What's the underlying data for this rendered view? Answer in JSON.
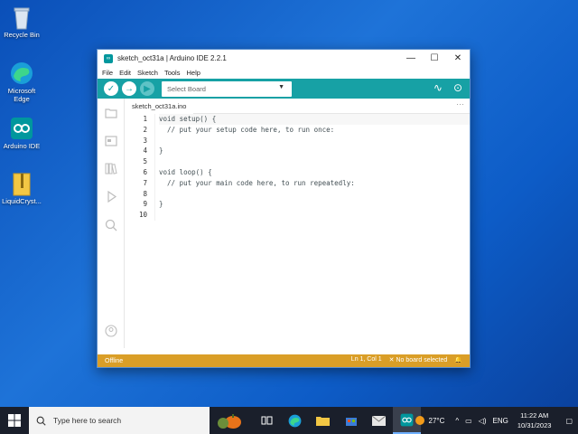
{
  "desktop": {
    "icons": [
      {
        "label": "Recycle Bin"
      },
      {
        "label": "Microsoft Edge"
      },
      {
        "label": "Arduino IDE"
      },
      {
        "label": "LiquidCryst..."
      }
    ]
  },
  "window": {
    "title": "sketch_oct31a | Arduino IDE 2.2.1",
    "app_icon_glyph": "∞",
    "controls": {
      "minimize": "—",
      "maximize": "☐",
      "close": "✕"
    },
    "menu": [
      "File",
      "Edit",
      "Sketch",
      "Tools",
      "Help"
    ]
  },
  "toolbar": {
    "verify": "✓",
    "upload": "→",
    "debug": "▶",
    "board_placeholder": "Select Board",
    "chevron": "▼",
    "serial_plotter": "∿",
    "serial_monitor": "⊙"
  },
  "editor": {
    "tab": "sketch_oct31a.ino",
    "tab_more": "···",
    "line_numbers": [
      "1",
      "2",
      "3",
      "4",
      "5",
      "6",
      "7",
      "8",
      "9",
      "10"
    ],
    "lines": [
      "void setup() {",
      "  // put your setup code here, to run once:",
      "",
      "}",
      "",
      "void loop() {",
      "  // put your main code here, to run repeatedly:",
      "",
      "}",
      ""
    ]
  },
  "status": {
    "left": "Offline",
    "position": "Ln 1, Col 1",
    "board": "✕ No board selected",
    "bell": "🔔"
  },
  "taskbar": {
    "search_placeholder": "Type here to search",
    "weather": "27°C",
    "language": "ENG",
    "time": "11:22 AM",
    "date": "10/31/2023"
  },
  "colors": {
    "toolbar": "#17a1a5",
    "statusbar": "#da9e27"
  }
}
